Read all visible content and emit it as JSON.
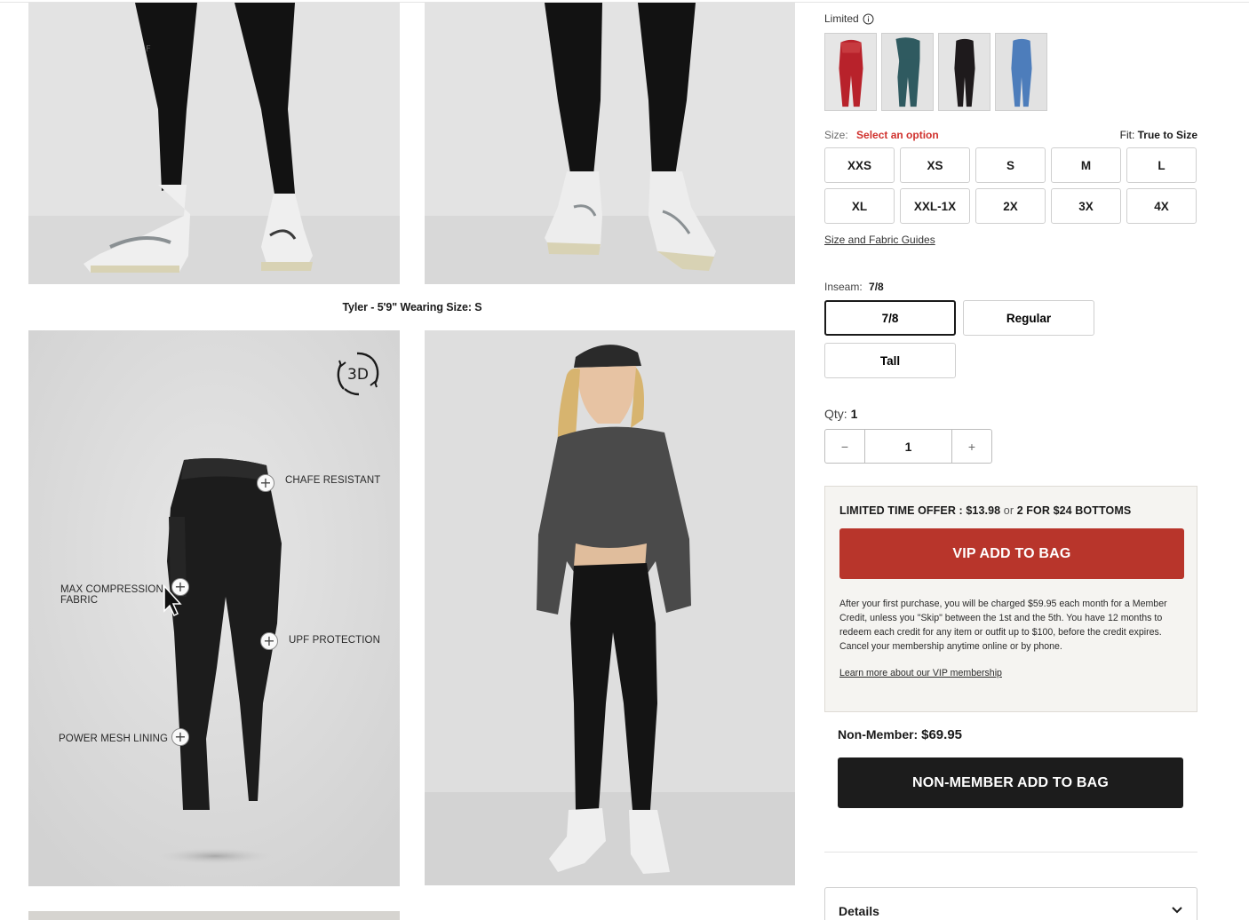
{
  "color": {
    "label": "Limited",
    "info_icon": "info-circle-icon",
    "swatches": [
      {
        "name": "red",
        "hex": "#b8222b"
      },
      {
        "name": "teal",
        "hex": "#2f5a60"
      },
      {
        "name": "black",
        "hex": "#1e1a1c"
      },
      {
        "name": "blue",
        "hex": "#4d7dbb"
      }
    ]
  },
  "size": {
    "label": "Size:",
    "prompt": "Select an option",
    "fit_label": "Fit:",
    "fit_value": "True to Size",
    "options": [
      "XXS",
      "XS",
      "S",
      "M",
      "L",
      "XL",
      "XXL-1X",
      "2X",
      "3X",
      "4X"
    ],
    "guides_link": "Size and Fabric Guides"
  },
  "inseam": {
    "label": "Inseam:",
    "value": "7/8",
    "options": [
      "7/8",
      "Regular",
      "Tall"
    ]
  },
  "qty": {
    "label": "Qty:",
    "value": "1",
    "minus": "−",
    "plus": "+"
  },
  "offer": {
    "headline_prefix": "LIMITED TIME OFFER : $13.98",
    "headline_or": "or",
    "headline_suffix": "2 FOR $24 BOTTOMS",
    "vip_button": "VIP ADD TO BAG",
    "disclaimer": "After your first purchase, you will be charged $59.95 each month for a Member Credit, unless you \"Skip\" between the 1st and the 5th. You have 12 months to redeem each credit for any item or outfit up to $100, before the credit expires. Cancel your membership anytime online or by phone.",
    "learn_more": "Learn more about our VIP membership"
  },
  "non_member": {
    "label": "Non-Member:",
    "price": "$69.95",
    "button": "NON-MEMBER ADD TO BAG"
  },
  "details": {
    "title": "Details"
  },
  "gallery": {
    "caption": "Tyler - 5'9\" Wearing Size: S",
    "badge_3d": "3D",
    "hotspots": {
      "chafe": "CHAFE RESISTANT",
      "compression_line1": "MAX COMPRESSION",
      "compression_line2": "FABRIC",
      "upf": "UPF PROTECTION",
      "mesh": "POWER MESH LINING"
    }
  }
}
